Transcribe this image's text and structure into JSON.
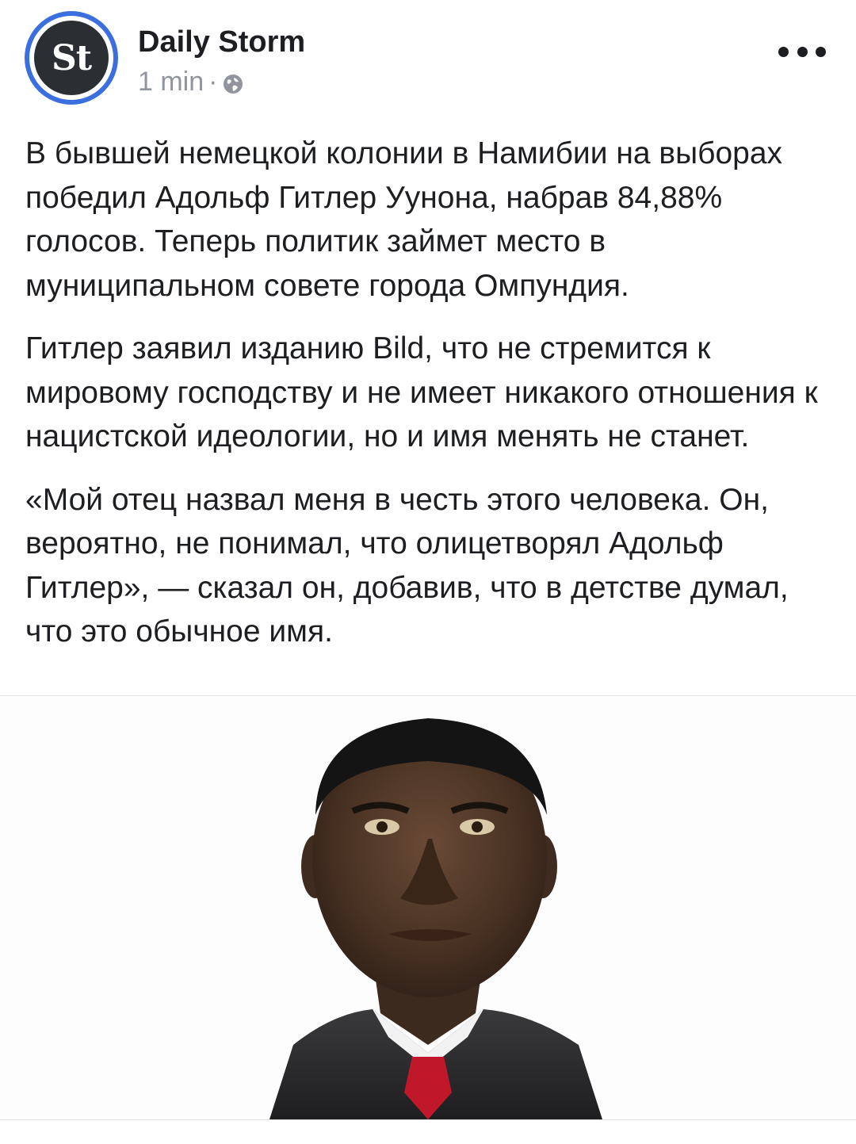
{
  "post": {
    "page_name": "Daily Storm",
    "avatar_text": "St",
    "time": "1 min",
    "separator": "·",
    "privacy_icon": "globe-icon",
    "more_icon": "more-dots-icon",
    "paragraphs": [
      "В бывшей немецкой колонии в Намибии на выборах победил Адольф Гитлер Уунона, набрав 84,88% голосов. Теперь политик займет место в муниципальном совете города Омпундия.",
      "Гитлер заявил изданию Bild, что не стремится к мировому господству и не имеет никакого отношения к нацистской идеологии, но и имя менять не станет.",
      "«Мой отец назвал меня в честь этого человека. Он, вероятно, не понимал, что олицетворял Адольф Гитлер», — сказал он, добавив, что в детстве думал, что это обычное имя."
    ]
  },
  "colors": {
    "avatar_ring": "#3b6fe0",
    "avatar_fill": "#2b2e33",
    "meta_text": "#90949c",
    "body_text": "#1c1e21"
  }
}
